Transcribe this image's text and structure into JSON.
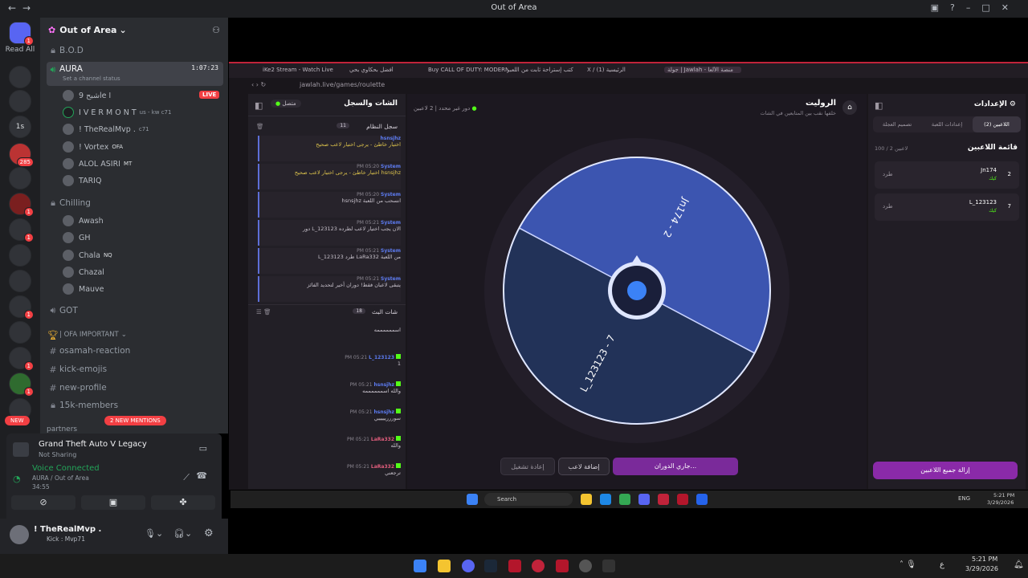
{
  "window": {
    "title": "Out of Area"
  },
  "discord": {
    "read_all": "Read All",
    "server_badges": [
      "1",
      "285",
      "1",
      "1",
      "1",
      "1",
      "1"
    ],
    "new_pill": "NEW",
    "guild_name": "Out of Area",
    "channels": {
      "bod": "B.O.D",
      "aura": "AURA",
      "aura_time": "1:07:23",
      "aura_status": "Set a channel status",
      "live": "LIVE",
      "aura_users": [
        {
          "name": "شبح 9le ا",
          "tag": ""
        },
        {
          "name": "I V E R M O N T",
          "tag": "us - kw  c71"
        },
        {
          "name": "! TheRealMvp .",
          "tag": "c71"
        },
        {
          "name": "! Vortex",
          "tag": "OFA"
        },
        {
          "name": "ALOL ASIRI",
          "tag": "MT"
        },
        {
          "name": "TARIQ",
          "tag": ""
        }
      ],
      "chilling": "Chilling",
      "chilling_users": [
        {
          "name": "Awash",
          "tag": ""
        },
        {
          "name": "GH",
          "tag": ""
        },
        {
          "name": "Chala",
          "tag": "NQ"
        },
        {
          "name": "Chazal",
          "tag": ""
        },
        {
          "name": "Mauve",
          "tag": ""
        }
      ],
      "got": "GOT",
      "category": "| OFA IMPORTANT",
      "text_channels": [
        "osamah-reaction",
        "kick-emojis",
        "new-profile",
        "15k-members"
      ],
      "partners": "partners",
      "mentions": "2 NEW MENTIONS"
    },
    "activity": {
      "title": "Grand Theft Auto V Legacy",
      "sub": "Not Sharing"
    },
    "voice": {
      "title": "Voice Connected",
      "channel": "AURA / Out of Area",
      "time": "34:55"
    },
    "user": {
      "name": "! TheRealMvp .",
      "status": "Kick : Mvp71"
    }
  },
  "browser": {
    "tabs": [
      "iKe2 Stream - Watch Live",
      "أفضل بحكاوي بحي",
      "Buy CALL OF DUTY: MODERN",
      "كتب إستراحة ثابت من اللعبر",
      "X / (1) الرئيسية",
      "جولة | Jawlah - منصة الألعا"
    ],
    "url": "jawlah.live/games/roulette",
    "chat": {
      "title": "الشات والسجل",
      "connected": "متصل",
      "log_title": "سجل النظام",
      "log_count": "11",
      "log": [
        {
          "who": "hsnsjhz",
          "time": "",
          "text": "اختيار خاطئ - يرجى اختيار لاعب صحيح",
          "yellow": true
        },
        {
          "who": "System",
          "time": "PM 05:20",
          "text": "اختيار خاطئ - يرجى اختيار لاعب صحيح hsnsjhz",
          "yellow": true
        },
        {
          "who": "System",
          "time": "PM 05:20",
          "text": "hsnsjhz انسحب من اللعبة",
          "yellow": false
        },
        {
          "who": "System",
          "time": "PM 05:21",
          "text": "دور L_123123 الان يجب اختيار لاعب لطرده",
          "yellow": false
        },
        {
          "who": "System",
          "time": "PM 05:21",
          "text": "L_123123 طرد LaRa332 من اللعبة",
          "yellow": false
        },
        {
          "who": "System",
          "time": "PM 05:21",
          "text": "يتبقى لاعبان فقط! دوران أخير لتحديد الفائز",
          "yellow": false
        }
      ],
      "live_title": "شات البث",
      "live_count": "18",
      "messages": [
        {
          "who": "",
          "time": "",
          "text": "اسممممممه",
          "red": false
        },
        {
          "who": "L_123123",
          "time": "PM 05:21",
          "text": "1",
          "red": false
        },
        {
          "who": "hsnsjhz",
          "time": "PM 05:21",
          "text": "والله اسممممممه",
          "red": false
        },
        {
          "who": "hsnsjhz",
          "time": "PM 05:21",
          "text": "سوررريييييي",
          "red": false
        },
        {
          "who": "LaRa332",
          "time": "PM 05:21",
          "text": "والله",
          "red": true
        },
        {
          "who": "LaRa332",
          "time": "PM 05:21",
          "text": "ترجعني",
          "red": true
        }
      ]
    },
    "roulette": {
      "title": "الروليت",
      "subtitle": "خلفها نقب بين المتابعين في الشات",
      "players_count": "2 لاعبين",
      "round": "دور غير محدد",
      "segments": [
        {
          "label": "Jn174 - 2",
          "color": "#3c55b0"
        },
        {
          "label": "L_123123 - 7",
          "color": "#223258"
        }
      ],
      "spinning": "جاري الدوران...",
      "add_player": "إضافة لاعب",
      "restart": "إعادة تشغيل"
    },
    "settings": {
      "title": "الإعدادات",
      "tabs": [
        "اللاعبين (2)",
        "إعدادات اللعبة",
        "تصميم العجلة"
      ],
      "list_title": "قائمة اللاعبين",
      "list_count": "100 / 2 لاعبين",
      "players": [
        {
          "name": "Jn174",
          "num": "2",
          "kick": "طرد",
          "sub": "كيك"
        },
        {
          "name": "L_123123",
          "num": "7",
          "kick": "طرد",
          "sub": "كيك"
        }
      ],
      "remove_all": "إزالة جميع اللاعبين"
    }
  },
  "taskbar": {
    "search": "Search",
    "lang": "ENG",
    "time_inner": "5:21 PM",
    "date_inner": "3/29/2026",
    "time": "5:21 PM",
    "date": "3/29/2026",
    "lang_outer": "ع"
  }
}
